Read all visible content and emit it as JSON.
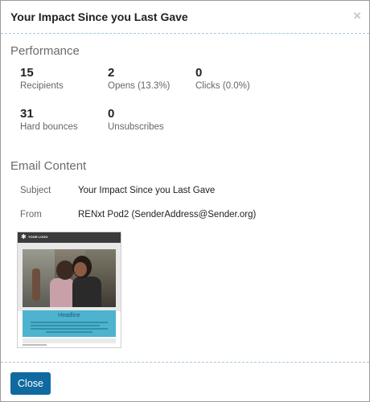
{
  "dialog": {
    "title": "Your Impact Since you Last Gave",
    "close_icon": "×"
  },
  "performance": {
    "heading": "Performance",
    "metrics": [
      {
        "value": "15",
        "label": "Recipients"
      },
      {
        "value": "2",
        "label": "Opens (13.3%)"
      },
      {
        "value": "0",
        "label": "Clicks (0.0%)"
      },
      {
        "value": "31",
        "label": "Hard bounces"
      },
      {
        "value": "0",
        "label": "Unsubscribes"
      }
    ]
  },
  "email_content": {
    "heading": "Email Content",
    "subject_label": "Subject",
    "subject_value": "Your Impact Since you Last Gave",
    "from_label": "From",
    "from_value": "RENxt Pod2 (SenderAddress@Sender.org)",
    "thumbnail": {
      "logo_text": "YOUR LOGO",
      "headline": "Headline"
    }
  },
  "footer": {
    "close_label": "Close"
  },
  "colors": {
    "primary_button": "#106aa0",
    "divider": "#a9c7de",
    "thumbnail_band": "#4db3cf"
  }
}
